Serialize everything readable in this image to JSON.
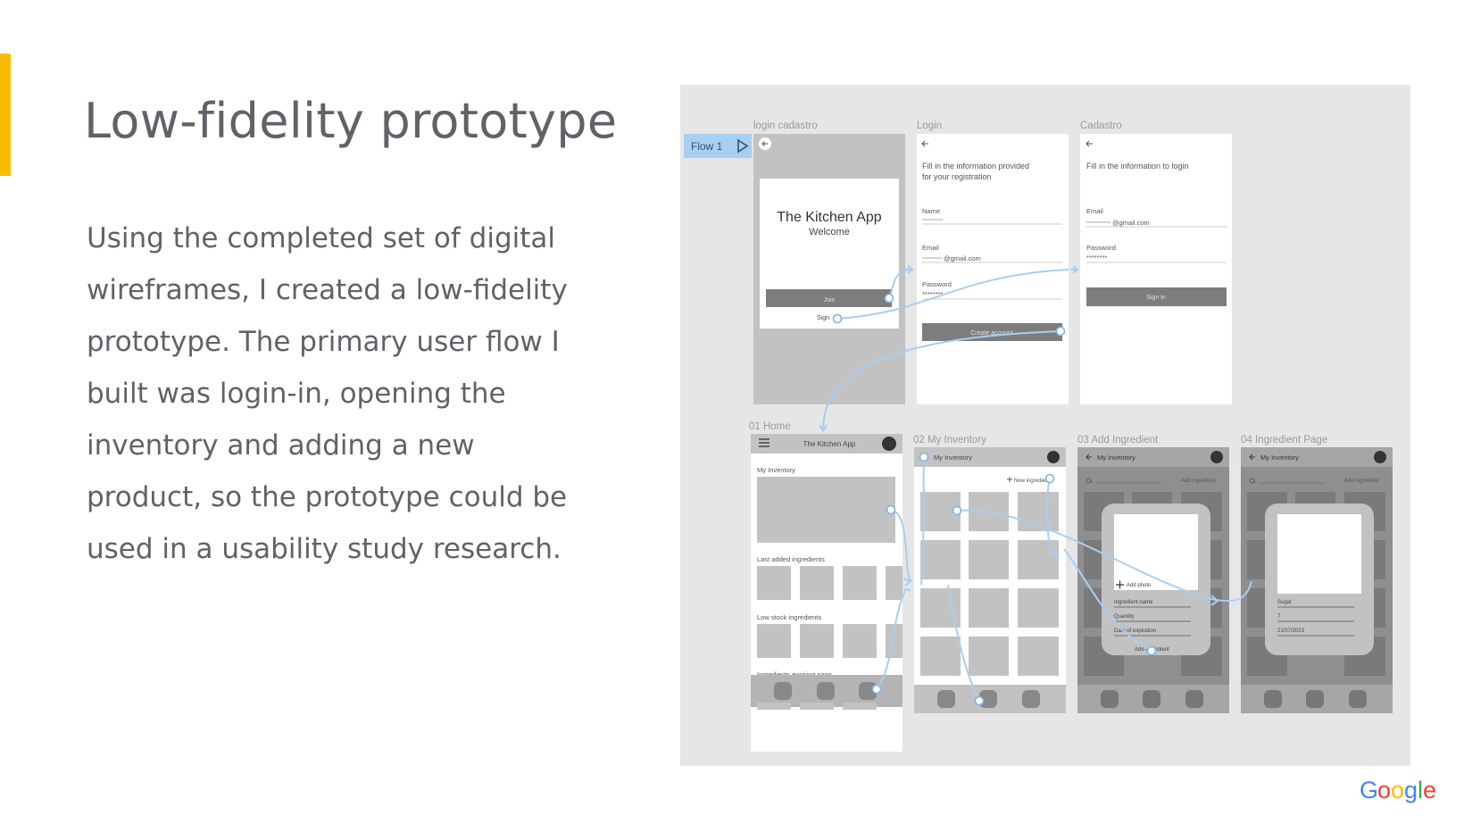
{
  "slide": {
    "title": "Low-fidelity prototype",
    "body": "Using the completed set of digital wireframes, I created a low-fidelity prototype. The primary user flow I built was login-in, opening the inventory and adding a new product, so the prototype could be used in a usability study research."
  },
  "colors": {
    "accent": "#F9BB04",
    "text": "#5f6368",
    "flow_blue": "#a8cef1",
    "panel": "#e6e6e6"
  },
  "prototype": {
    "flow_label": "Flow 1",
    "screens": {
      "login_cadastro": {
        "label": "login cadastro",
        "app_name": "The Kitchen App",
        "welcome": "Welcome",
        "join": "Join",
        "sign": "Sign"
      },
      "login": {
        "label": "Login",
        "instruction_line1": "Fill in the information provided",
        "instruction_line2": "for your registration",
        "name_label": "Name",
        "email_label": "Email",
        "email_value": "@gmail.com",
        "password_label": "Password",
        "password_value": "********",
        "create_button": "Create account"
      },
      "cadastro": {
        "label": "Cadastro",
        "instruction": "Fill in the information to login",
        "email_label": "Email",
        "email_value": "@gmail.com",
        "password_label": "Password",
        "password_value": "********",
        "signin_button": "Sign in"
      },
      "home": {
        "label": "01 Home",
        "header_title": "The Kitchen App",
        "my_inventory": "My Inventory",
        "last_added": "Last added ingredients",
        "low_stock": "Low stock ingredients",
        "expiring": "Ingredients expiring soon"
      },
      "my_inventory": {
        "label": "02 My Inventory",
        "header_title": "My Inventory",
        "new_ingredient": "New ingredient"
      },
      "add_ingredient": {
        "label": "03 Add Ingredient",
        "header_title": "My Inventory",
        "add_ingredient_action": "Add ingredient",
        "add_photo": "Add photo",
        "field_name": "Ingredient name",
        "field_quantity": "Quantity",
        "field_expiration": "Date of expiration",
        "add_button": "Add ingredient"
      },
      "ingredient_page": {
        "label": "04 Ingredient Page",
        "header_title": "My Inventory",
        "add_ingredient_action": "Add ingredient",
        "value_name": "Sugar",
        "value_quantity": "7",
        "value_date": "21/07/2023"
      }
    }
  }
}
